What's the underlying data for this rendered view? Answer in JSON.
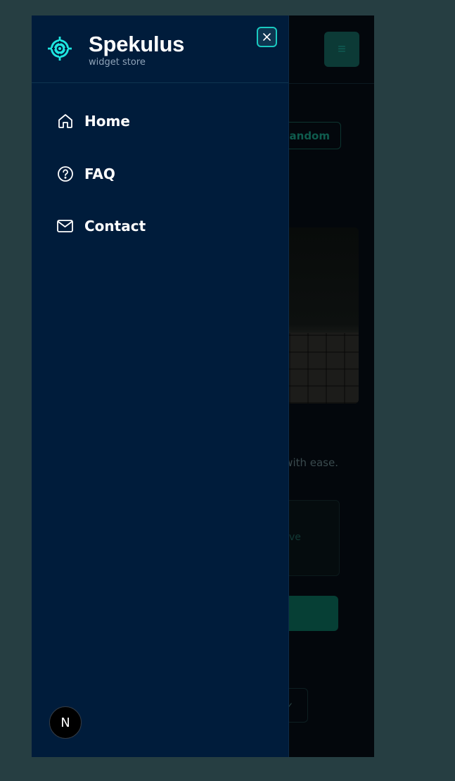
{
  "brand": {
    "name": "Spekulus",
    "tagline": "widget store",
    "accent_color": "#1ee6e0",
    "logo_icon": "crosshair-target-icon"
  },
  "drawer": {
    "close_icon": "close-icon",
    "nav_items": [
      {
        "label": "Home",
        "icon": "home-icon"
      },
      {
        "label": "FAQ",
        "icon": "help-circle-icon"
      },
      {
        "label": "Contact",
        "icon": "mail-icon"
      }
    ]
  },
  "background_page": {
    "menu_icon": "hamburger-menu-icon",
    "random_button_label": "Random",
    "text_fragment": "with ease.",
    "card_fragment": "ve",
    "select_icon": "chevron-down-icon"
  },
  "dev_badge": {
    "letter": "N",
    "icon": "nextjs-logo-icon"
  },
  "colors": {
    "page_background": "#263e42",
    "drawer_background": "#001c3b",
    "close_border": "#1ac9c0"
  }
}
